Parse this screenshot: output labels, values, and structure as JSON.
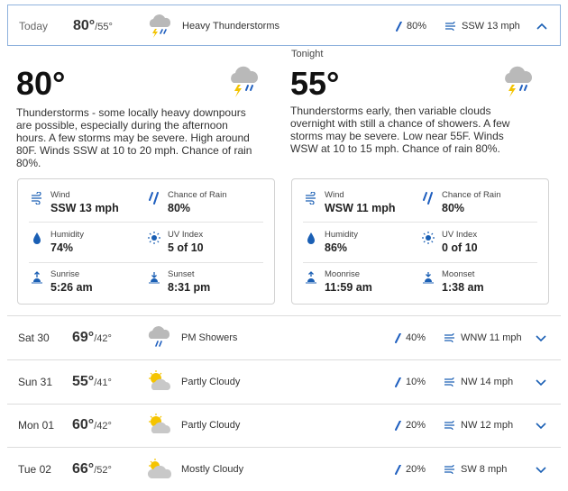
{
  "colors": {
    "accent": "#1a5fb4",
    "rain_drop": "#1f5fbf",
    "cloud": "#b9b9b9",
    "bolt": "#f3c300",
    "sun": "#f5c400"
  },
  "today": {
    "day": "Today",
    "hi": "80°",
    "lo": "/55°",
    "icon": "thunderstorm-icon",
    "condition": "Heavy Thunderstorms",
    "precip": "80%",
    "wind": "SSW 13 mph"
  },
  "day_panel": {
    "temp": "80°",
    "icon": "thunderstorm-icon",
    "description": "Thunderstorms - some locally heavy downpours are possible, especially during the afternoon hours. A few storms may be severe. High around 80F. Winds SSW at 10 to 20 mph. Chance of rain 80%.",
    "details": {
      "wind_label": "Wind",
      "wind_value": "SSW 13 mph",
      "rain_label": "Chance of Rain",
      "rain_value": "80%",
      "humidity_label": "Humidity",
      "humidity_value": "74%",
      "uv_label": "UV Index",
      "uv_value": "5 of 10",
      "sunrise_label": "Sunrise",
      "sunrise_value": "5:26 am",
      "sunset_label": "Sunset",
      "sunset_value": "8:31 pm"
    }
  },
  "night_panel": {
    "label": "Tonight",
    "temp": "55°",
    "icon": "thunderstorm-icon",
    "description": "Thunderstorms early, then variable clouds overnight with still a chance of showers. A few storms may be severe. Low near 55F. Winds WSW at 10 to 15 mph. Chance of rain 80%.",
    "details": {
      "wind_label": "Wind",
      "wind_value": "WSW 11 mph",
      "rain_label": "Chance of Rain",
      "rain_value": "80%",
      "humidity_label": "Humidity",
      "humidity_value": "86%",
      "uv_label": "UV Index",
      "uv_value": "0 of 10",
      "moonrise_label": "Moonrise",
      "moonrise_value": "11:59 am",
      "moonset_label": "Moonset",
      "moonset_value": "1:38 am"
    }
  },
  "forecast": [
    {
      "day": "Sat 30",
      "hi": "69°",
      "lo": "/42°",
      "icon": "rain-showers-icon",
      "condition": "PM Showers",
      "precip": "40%",
      "wind": "WNW 11 mph"
    },
    {
      "day": "Sun 31",
      "hi": "55°",
      "lo": "/41°",
      "icon": "partly-cloudy-icon",
      "condition": "Partly Cloudy",
      "precip": "10%",
      "wind": "NW 14 mph"
    },
    {
      "day": "Mon 01",
      "hi": "60°",
      "lo": "/42°",
      "icon": "partly-cloudy-icon",
      "condition": "Partly Cloudy",
      "precip": "20%",
      "wind": "NW 12 mph"
    },
    {
      "day": "Tue 02",
      "hi": "66°",
      "lo": "/52°",
      "icon": "mostly-cloudy-icon",
      "condition": "Mostly Cloudy",
      "precip": "20%",
      "wind": "SW 8 mph"
    }
  ]
}
